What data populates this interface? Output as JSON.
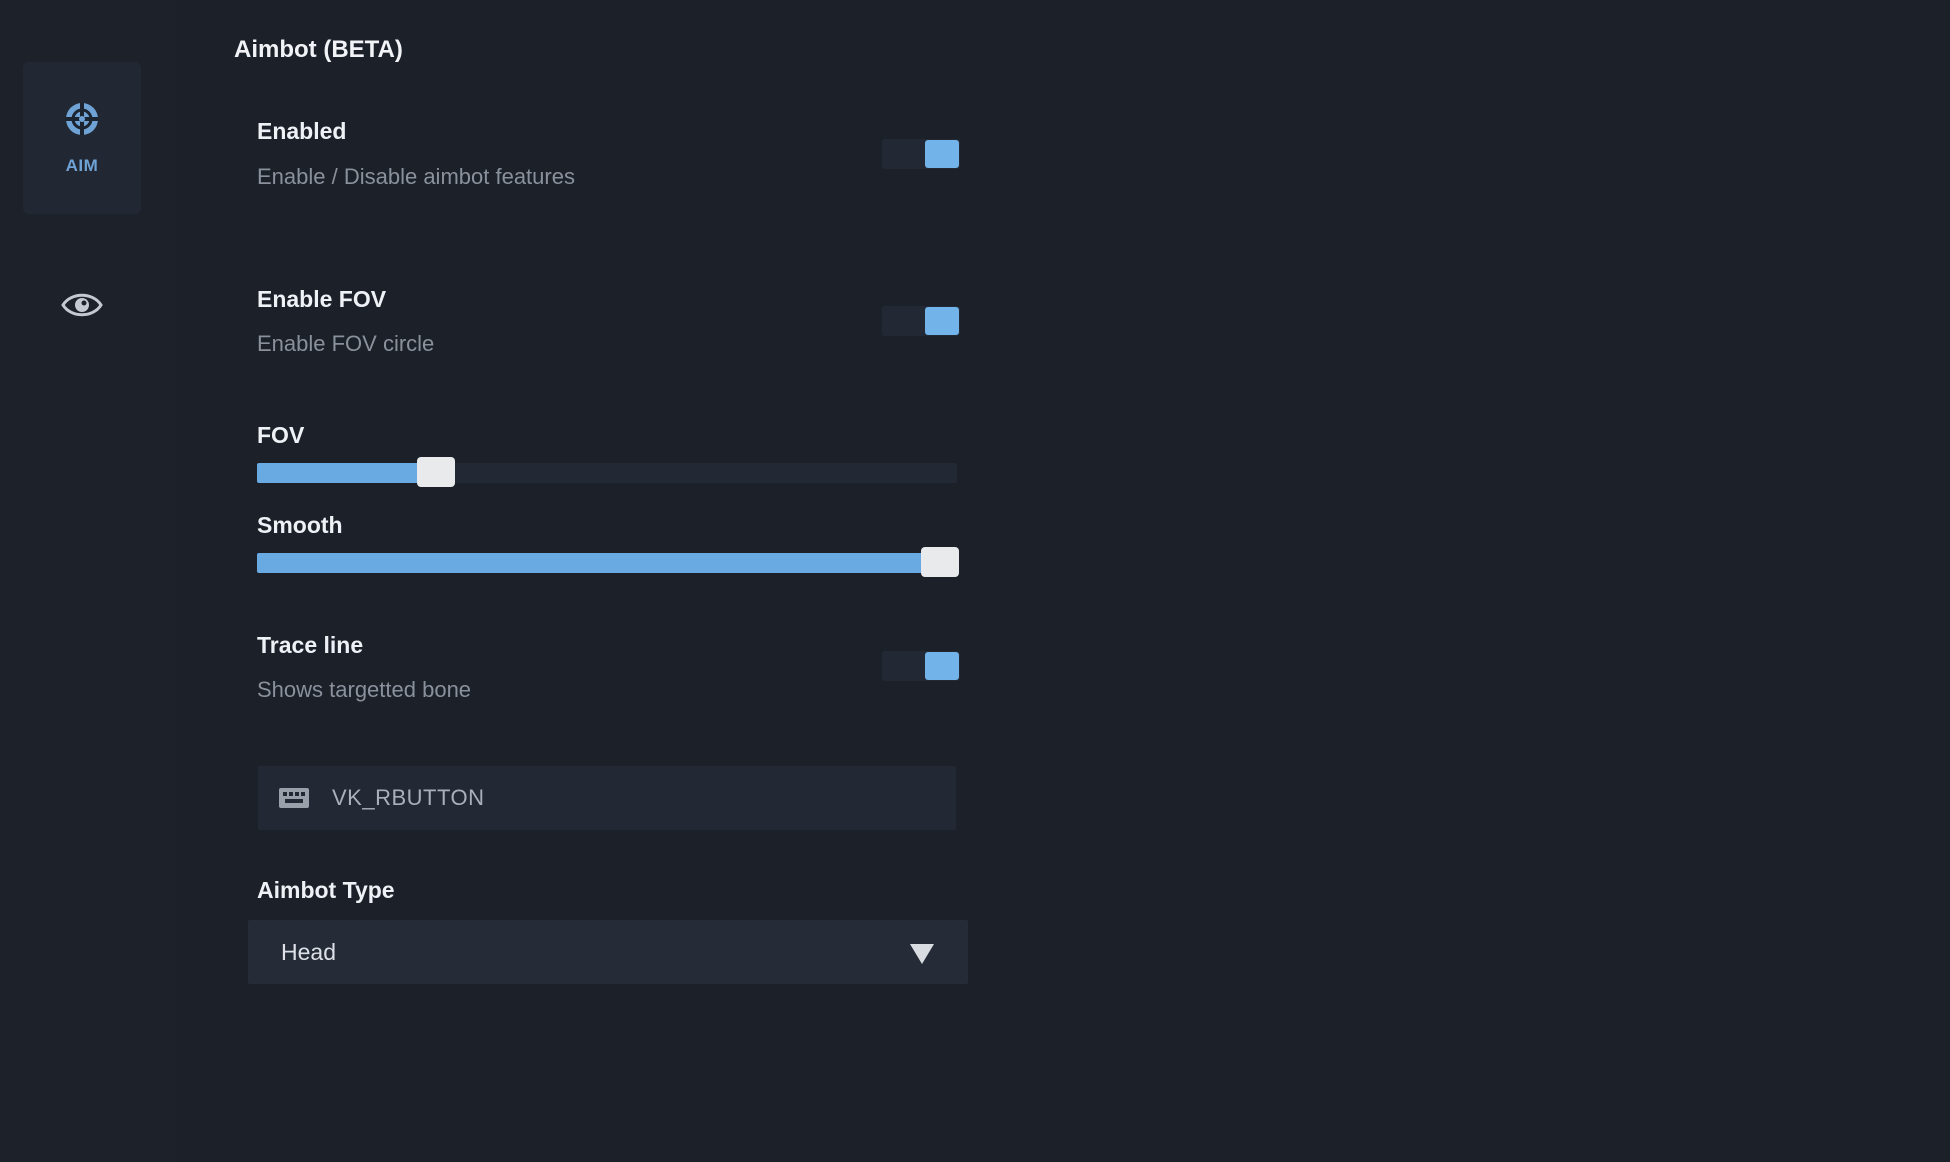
{
  "sidebar": {
    "items": [
      {
        "label": "AIM",
        "icon": "crosshair-icon",
        "active": true
      },
      {
        "label": "",
        "icon": "eye-icon",
        "active": false
      }
    ]
  },
  "section": {
    "title": "Aimbot (BETA)"
  },
  "settings": {
    "enabled": {
      "label": "Enabled",
      "description": "Enable / Disable aimbot features",
      "value": true
    },
    "enable_fov": {
      "label": "Enable FOV",
      "description": "Enable FOV circle",
      "value": true
    },
    "fov": {
      "label": "FOV",
      "fraction": 0.255
    },
    "smooth": {
      "label": "Smooth",
      "fraction": 0.975
    },
    "trace_line": {
      "label": "Trace line",
      "description": "Shows targetted bone",
      "value": true
    },
    "keybind": {
      "icon": "keyboard-icon",
      "value": "VK_RBUTTON"
    },
    "aimbot_type": {
      "label": "Aimbot Type",
      "value": "Head"
    }
  },
  "colors": {
    "background": "#1b2029",
    "accent": "#72b4ea",
    "panel": "#232934",
    "thumb": "#e9eaec"
  }
}
